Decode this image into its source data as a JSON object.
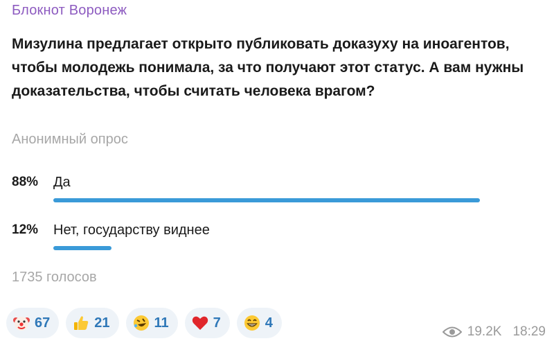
{
  "post": {
    "channel": "Блокнот Воронеж",
    "question": "Мизулина предлагает открыто публиковать доказуху на иноагентов, чтобы молодежь понимала, за что получают этот статус. А вам нужны доказательства, чтобы считать человека врагом?",
    "poll_type": "Анонимный опрос",
    "options": [
      {
        "percent": "88%",
        "label": "Да",
        "share": 0.88
      },
      {
        "percent": "12%",
        "label": "Нет, государству виднее",
        "share": 0.12
      }
    ],
    "votes": "1735 голосов",
    "reactions": [
      {
        "icon": "clown-face-icon",
        "count": "67"
      },
      {
        "icon": "thumbs-up-icon",
        "count": "21"
      },
      {
        "icon": "rofl-face-icon",
        "count": "11"
      },
      {
        "icon": "red-heart-icon",
        "count": "7"
      },
      {
        "icon": "grinning-face-icon",
        "count": "4"
      }
    ],
    "views": "19.2K",
    "time": "18:29"
  },
  "colors": {
    "channel": "#8d5bc0",
    "bar": "#3a9ad8",
    "reaction_bg": "#eef3f8",
    "reaction_count": "#2f78b8"
  }
}
